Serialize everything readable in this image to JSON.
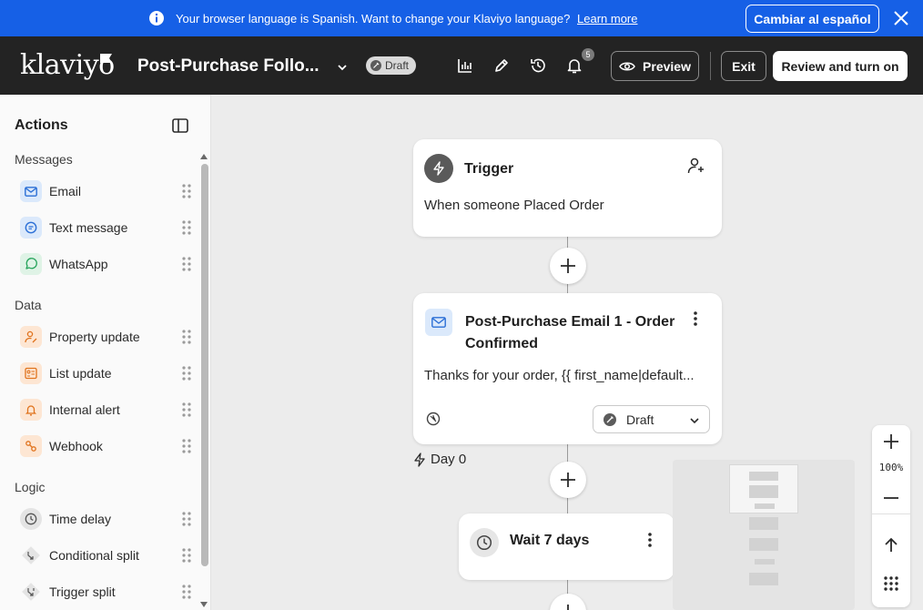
{
  "banner": {
    "message": "Your browser language is Spanish. Want to change your Klaviyo language?",
    "link": "Learn more",
    "switch_button": "Cambiar al español"
  },
  "header": {
    "logo": "klaviyo",
    "flow_title": "Post-Purchase Follo...",
    "status": "Draft",
    "notification_count": "5",
    "preview_label": "Preview",
    "exit_label": "Exit",
    "review_label": "Review and turn on"
  },
  "sidebar": {
    "title": "Actions",
    "sections": [
      {
        "label": "Messages",
        "items": [
          {
            "label": "Email",
            "icon": "email-icon"
          },
          {
            "label": "Text message",
            "icon": "sms-icon"
          },
          {
            "label": "WhatsApp",
            "icon": "whatsapp-icon"
          }
        ]
      },
      {
        "label": "Data",
        "items": [
          {
            "label": "Property update",
            "icon": "person-edit-icon"
          },
          {
            "label": "List update",
            "icon": "list-card-icon"
          },
          {
            "label": "Internal alert",
            "icon": "bell-icon"
          },
          {
            "label": "Webhook",
            "icon": "webhook-icon"
          }
        ]
      },
      {
        "label": "Logic",
        "items": [
          {
            "label": "Time delay",
            "icon": "clock-icon"
          },
          {
            "label": "Conditional split",
            "icon": "split-icon"
          },
          {
            "label": "Trigger split",
            "icon": "split-icon"
          }
        ]
      }
    ]
  },
  "canvas": {
    "trigger": {
      "title": "Trigger",
      "description": "When someone Placed Order"
    },
    "email": {
      "title_line1": "Post-Purchase Email 1 - Order",
      "title_line2": "Confirmed",
      "preview": "Thanks for your order, {{ first_name|default...",
      "status": "Draft"
    },
    "day_label": "Day 0",
    "delay": {
      "title": "Wait 7 days"
    },
    "zoom_level": "100%"
  },
  "colors": {
    "banner": "#1660e6",
    "header": "#232323",
    "canvas": "#ececec"
  }
}
